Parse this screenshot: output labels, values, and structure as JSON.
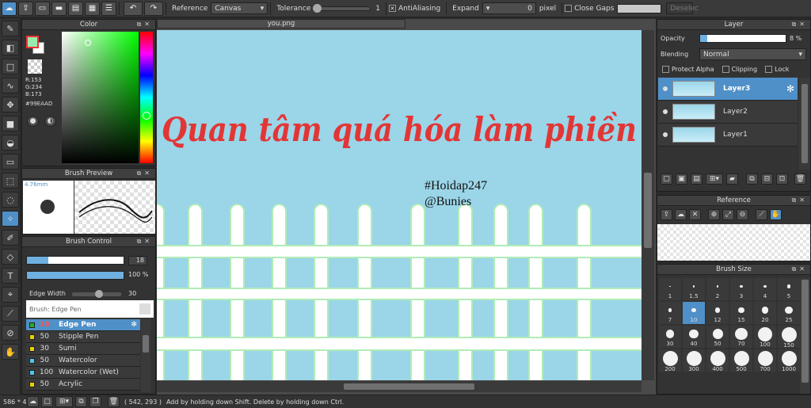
{
  "toolbar": {
    "reference_label": "Reference",
    "reference_value": "Canvas",
    "tolerance_label": "Tolerance",
    "tolerance_value": "1",
    "antialiasing_label": "AntiAliasing",
    "expand_label": "Expand",
    "expand_value": "0",
    "expand_unit": "pixel",
    "close_gaps_label": "Close Gaps",
    "deselect_label": "Deselec"
  },
  "document": {
    "tab_title": "you.png"
  },
  "artwork": {
    "headline": "Quan tâm quá hóa làm phiền",
    "hashtag": "#Hoidap247",
    "handle": "@Bunies"
  },
  "color_panel": {
    "title": "Color",
    "r_label": "R:153",
    "g_label": "G:234",
    "b_label": "B:173",
    "hex": "#99EAAD",
    "fg_color": "#99EAAD"
  },
  "brush_preview": {
    "title": "Brush Preview",
    "size": "4.76mm"
  },
  "brush_control": {
    "title": "Brush Control",
    "size_value": "18",
    "opacity_value": "100",
    "opacity_unit": "%",
    "size_fill": 0.22,
    "opacity_fill": 1.0,
    "edge_width_label": "Edge Width",
    "edge_width_value": "30",
    "edge_width_fill": 0.55,
    "brush_name_label": "Brush: Edge Pen",
    "brushes": [
      {
        "size": "18",
        "name": "Edge Pen",
        "color": "#27b027",
        "selected": true
      },
      {
        "size": "50",
        "name": "Stipple Pen",
        "color": "#e8d000",
        "selected": false
      },
      {
        "size": "30",
        "name": "Sumi",
        "color": "#e8d000",
        "selected": false
      },
      {
        "size": "50",
        "name": "Watercolor",
        "color": "#4fc8e8",
        "selected": false
      },
      {
        "size": "100",
        "name": "Watercolor (Wet)",
        "color": "#4fc8e8",
        "selected": false
      },
      {
        "size": "50",
        "name": "Acrylic",
        "color": "#e8d000",
        "selected": false
      }
    ]
  },
  "layer_panel": {
    "title": "Layer",
    "opacity_label": "Opacity",
    "opacity_value": "8",
    "opacity_unit": "%",
    "opacity_fill": 0.08,
    "blending_label": "Blending",
    "blending_value": "Normal",
    "protect_alpha_label": "Protect Alpha",
    "clipping_label": "Clipping",
    "lock_label": "Lock",
    "layers": [
      {
        "name": "Layer3",
        "selected": true
      },
      {
        "name": "Layer2",
        "selected": false
      },
      {
        "name": "Layer1",
        "selected": false
      }
    ]
  },
  "reference_panel": {
    "title": "Reference"
  },
  "brush_size_panel": {
    "title": "Brush Size",
    "sizes": [
      "1",
      "1.5",
      "2",
      "3",
      "4",
      "5",
      "7",
      "10",
      "12",
      "15",
      "20",
      "25",
      "30",
      "40",
      "50",
      "70",
      "100",
      "150",
      "200",
      "300",
      "400",
      "500",
      "700",
      "1000"
    ],
    "selected": "10"
  },
  "status_bar": {
    "zoom": "586 * 4",
    "coords": "( 542, 293 )",
    "hint": "Add by holding down Shift. Delete by holding down Ctrl."
  }
}
